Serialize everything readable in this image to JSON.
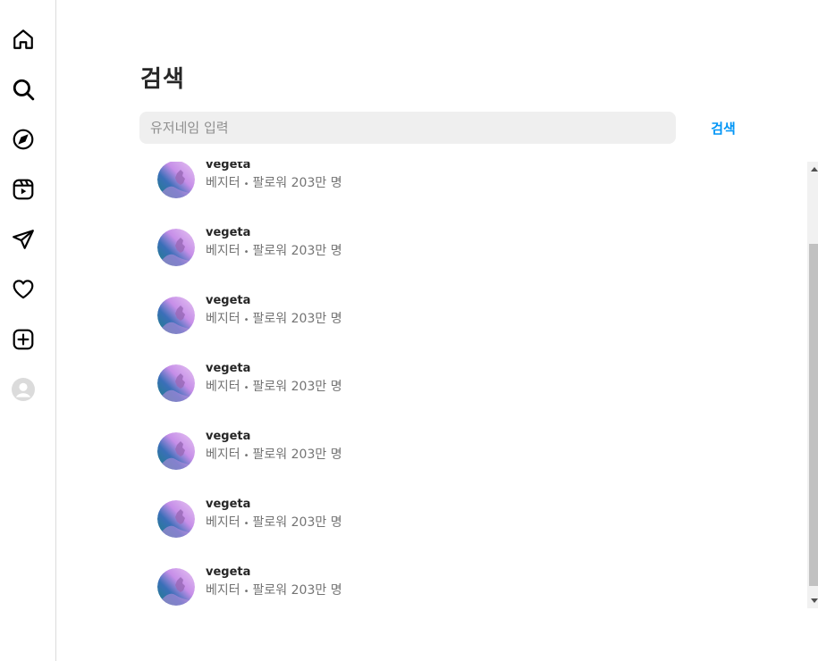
{
  "sidebar": {
    "icons": [
      "home-icon",
      "search-icon",
      "explore-icon",
      "reels-icon",
      "messages-icon",
      "notifications-icon",
      "create-icon",
      "profile-icon"
    ]
  },
  "search": {
    "title": "검색",
    "placeholder": "유저네임 입력",
    "value": "",
    "button_label": "검색"
  },
  "results": [
    {
      "username": "vegeta",
      "name": "베지터",
      "followers": "팔로워 203만 명"
    },
    {
      "username": "vegeta",
      "name": "베지터",
      "followers": "팔로워 203만 명"
    },
    {
      "username": "vegeta",
      "name": "베지터",
      "followers": "팔로워 203만 명"
    },
    {
      "username": "vegeta",
      "name": "베지터",
      "followers": "팔로워 203만 명"
    },
    {
      "username": "vegeta",
      "name": "베지터",
      "followers": "팔로워 203만 명"
    },
    {
      "username": "vegeta",
      "name": "베지터",
      "followers": "팔로워 203만 명"
    },
    {
      "username": "vegeta",
      "name": "베지터",
      "followers": "팔로워 203만 명"
    }
  ],
  "separator": "•",
  "colors": {
    "accent": "#0095f6",
    "input_bg": "#efefef",
    "text_primary": "#262626",
    "text_secondary": "#737373",
    "border": "#dbdbdb"
  }
}
